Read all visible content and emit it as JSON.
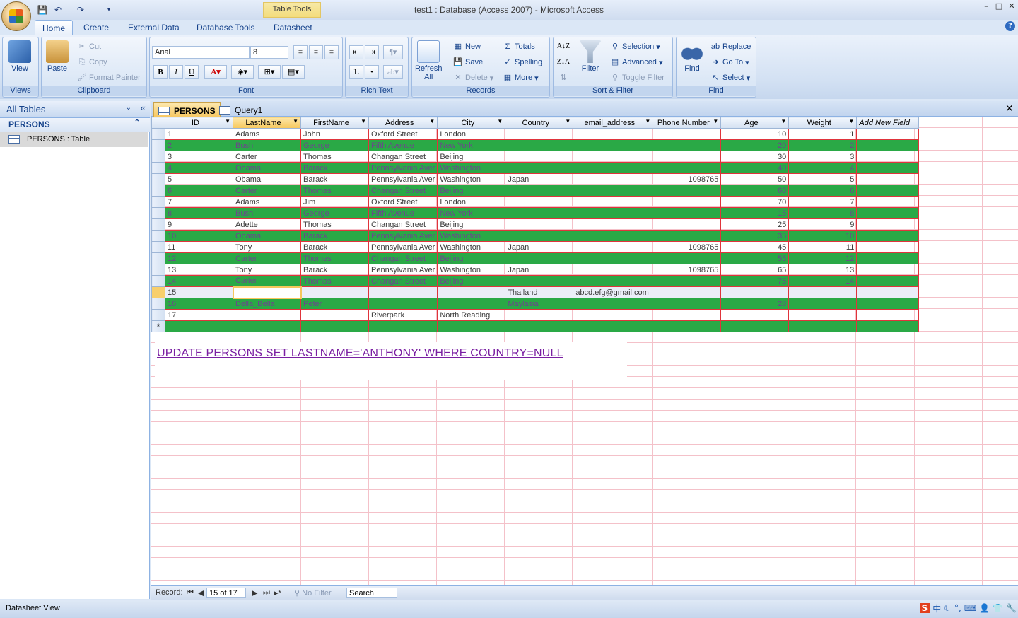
{
  "window": {
    "title": "test1 : Database (Access 2007) - Microsoft Access",
    "context_tab": "Table Tools",
    "min": "–",
    "max": "□",
    "close": "✕"
  },
  "tabs": [
    "Home",
    "Create",
    "External Data",
    "Database Tools",
    "Datasheet"
  ],
  "ribbon": {
    "views": {
      "label": "Views",
      "view": "View"
    },
    "clipboard": {
      "label": "Clipboard",
      "paste": "Paste",
      "cut": "Cut",
      "copy": "Copy",
      "format_painter": "Format Painter"
    },
    "font": {
      "label": "Font",
      "font_name": "Arial",
      "font_size": "8",
      "bold": "B",
      "italic": "I",
      "underline": "U"
    },
    "rich_text": {
      "label": "Rich Text"
    },
    "records": {
      "label": "Records",
      "refresh": "Refresh",
      "refresh2": "All",
      "new": "New",
      "save": "Save",
      "delete": "Delete",
      "totals": "Totals",
      "spelling": "Spelling",
      "more": "More"
    },
    "sort_filter": {
      "label": "Sort & Filter",
      "filter": "Filter",
      "selection": "Selection",
      "advanced": "Advanced",
      "toggle": "Toggle Filter"
    },
    "find": {
      "label": "Find",
      "find": "Find",
      "replace": "Replace",
      "goto": "Go To",
      "select": "Select"
    }
  },
  "nav": {
    "header": "All Tables",
    "group": "PERSONS",
    "item": "PERSONS : Table"
  },
  "doc_tabs": [
    "PERSONS",
    "Query1"
  ],
  "grid": {
    "columns": [
      "ID",
      "LastName",
      "FirstName",
      "Address",
      "City",
      "Country",
      "email_address",
      "Phone Number",
      "Age",
      "Weight",
      "Add New Field"
    ],
    "rows": [
      [
        "1",
        "Adams",
        "John",
        "Oxford Street",
        "London",
        "",
        "",
        "",
        "10",
        "1"
      ],
      [
        "2",
        "Bush",
        "George",
        "Fifth Avenue",
        "New York",
        "",
        "",
        "",
        "20",
        "2"
      ],
      [
        "3",
        "Carter",
        "Thomas",
        "Changan Street",
        "Beijing",
        "",
        "",
        "",
        "30",
        "3"
      ],
      [
        "4",
        "Obama",
        "Barack",
        "Pennsylvania Aver",
        "Washington",
        "",
        "",
        "",
        "40",
        "4"
      ],
      [
        "5",
        "Obama",
        "Barack",
        "Pennsylvania Aver",
        "Washington",
        "Japan",
        "",
        "1098765",
        "50",
        "5"
      ],
      [
        "6",
        "Carter",
        "Thomas",
        "Changan Street",
        "Beijing",
        "",
        "",
        "",
        "60",
        "6"
      ],
      [
        "7",
        "Adams",
        "Jim",
        "Oxford Street",
        "London",
        "",
        "",
        "",
        "70",
        "7"
      ],
      [
        "8",
        "Bush",
        "George",
        "Fifth Avenue",
        "New York",
        "",
        "",
        "",
        "15",
        "8"
      ],
      [
        "9",
        "Adette",
        "Thomas",
        "Changan Street",
        "Beijing",
        "",
        "",
        "",
        "25",
        "9"
      ],
      [
        "10",
        "Obama",
        "Barack",
        "Pennsylvania Aver",
        "Washington",
        "",
        "",
        "",
        "35",
        "10"
      ],
      [
        "11",
        "Tony",
        "Barack",
        "Pennsylvania Aver",
        "Washington",
        "Japan",
        "",
        "1098765",
        "45",
        "11"
      ],
      [
        "12",
        "Carter",
        "Thomas",
        "Changan Street",
        "Beijing",
        "",
        "",
        "",
        "55",
        "12"
      ],
      [
        "13",
        "Tony",
        "Barack",
        "Pennsylvania Aver",
        "Washington",
        "Japan",
        "",
        "1098765",
        "65",
        "13"
      ],
      [
        "14",
        "Carter",
        "Thomas",
        "Changan Street",
        "Beijing",
        "",
        "",
        "",
        "75",
        "14"
      ],
      [
        "15",
        "",
        "",
        "",
        "",
        "Thailand",
        "abcd.efg@gmail.com",
        "",
        "",
        ""
      ],
      [
        "16",
        "Della_Bella",
        "Peter",
        "",
        "",
        "Maylasia",
        "",
        "",
        "28",
        ""
      ],
      [
        "17",
        "",
        "",
        "Riverpark",
        "North Reading",
        "",
        "",
        "",
        "",
        ""
      ]
    ],
    "new_row_marker": "*"
  },
  "sql_text": "UPDATE PERSONS SET LASTNAME='ANTHONY' WHERE COUNTRY=NULL",
  "record_nav": {
    "label": "Record:",
    "current": "15 of 17",
    "filter": "No Filter",
    "search": "Search"
  },
  "status": {
    "text": "Datasheet View"
  },
  "colors": {
    "alt_row": "#2aa946",
    "grid_line": "#e0343b",
    "sql": "#7a1fa2"
  }
}
